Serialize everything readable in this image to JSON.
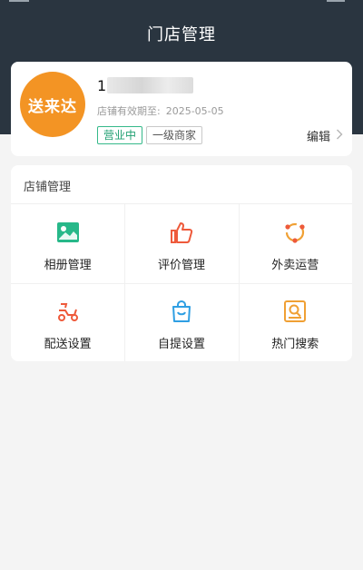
{
  "header": {
    "title": "门店管理"
  },
  "store": {
    "logo_text": "送来达",
    "phone_visible_prefix": "1",
    "valid_label": "店铺有效期至:",
    "valid_date": "2025-05-05",
    "status_tag": "营业中",
    "level_tag": "一级商家",
    "edit_label": "编辑"
  },
  "management": {
    "title": "店铺管理",
    "items": [
      {
        "label": "相册管理",
        "icon": "photo-album-icon",
        "color": "#27b889"
      },
      {
        "label": "评价管理",
        "icon": "thumbs-up-icon",
        "color": "#ee5a3b"
      },
      {
        "label": "外卖运营",
        "icon": "operations-cycle-icon",
        "color": "#f0a034"
      },
      {
        "label": "配送设置",
        "icon": "scooter-icon",
        "color": "#ee5a3b"
      },
      {
        "label": "自提设置",
        "icon": "shopping-bag-icon",
        "color": "#2f9fe3"
      },
      {
        "label": "热门搜索",
        "icon": "search-icon",
        "color": "#f0a034"
      }
    ]
  }
}
